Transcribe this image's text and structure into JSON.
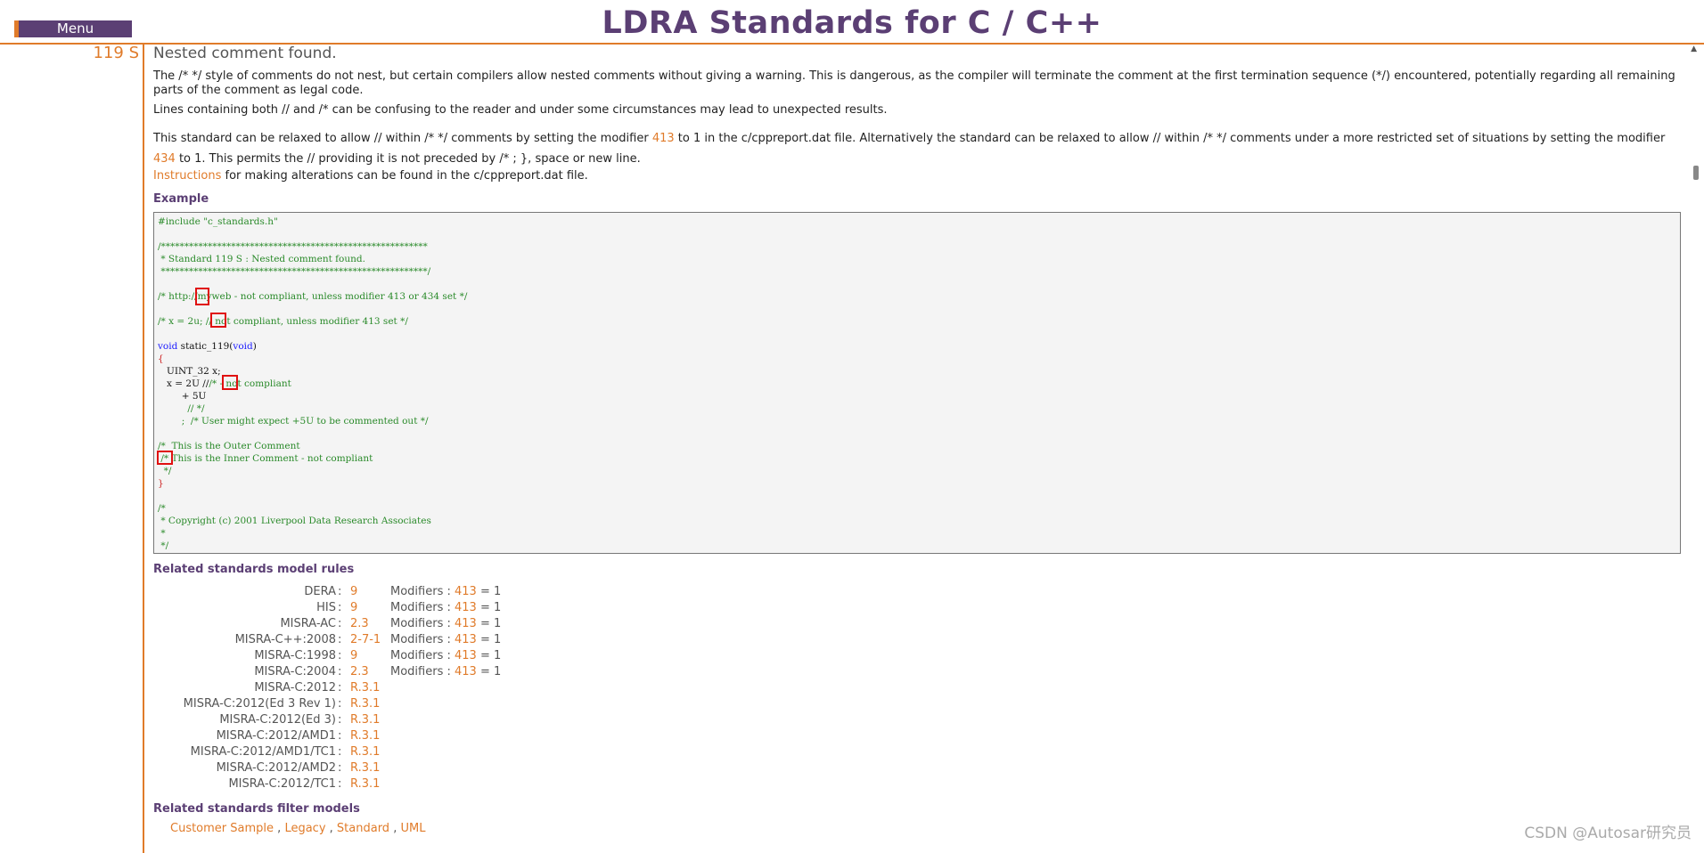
{
  "header": {
    "menu_label": "Menu",
    "title": "LDRA Standards for C / C++"
  },
  "rule": {
    "id": "119 S",
    "title": "Nested comment found.",
    "para1": "The /* */ style of comments do not nest, but certain compilers allow nested comments without giving a warning. This is dangerous, as the compiler will terminate the comment at the first termination sequence (*/) encountered, potentially regarding all remaining parts of the comment as legal code.",
    "para2": "Lines containing both // and /* can be confusing to the reader and under some circumstances may lead to unexpected results.",
    "para3a": "This standard can be relaxed to allow // within /* */ comments by setting the modifier ",
    "mod413": "413",
    "para3b": " to 1 in the c/cppreport.dat file. Alternatively the standard can be relaxed to allow // within /* */ comments under a more restricted set of situations by setting the modifier ",
    "mod434": "434",
    "para3c": " to 1. This permits the // providing it is not preceded by /* ; }, space or new line.",
    "instructions_link": "Instructions",
    "instructions_rest": " for making alterations can be found in the c/cppreport.dat file."
  },
  "example": {
    "heading": "Example",
    "lines": {
      "l1": "#include \"c_standards.h\"",
      "l2": "/*********************************************************",
      "l3": " * Standard 119 S : Nested comment found.",
      "l4": " *********************************************************/",
      "l5": "/* http://myweb - not compliant, unless modifier 413 or 434 set */",
      "l6": "/* x = 2u; // not compliant, unless modifier 413 set */",
      "l7_kw1": "void",
      "l7_mid": " static_119(",
      "l7_kw2": "void",
      "l7_end": ")",
      "l8": "{",
      "l9": "   UINT_32 x;",
      "l10a": "   x = 2U //",
      "l10b": "/*",
      "l10c": " - not compliant",
      "l11": "        + 5U",
      "l12": "          // */",
      "l13": "        ;  /* User might expect +5U to be commented out */",
      "l14": "/*  This is the Outer Comment",
      "l15": " /* This is the Inner Comment - not compliant",
      "l16": "  */",
      "l17": "}",
      "l18": "/*",
      "l19": " * Copyright (c) 2001 Liverpool Data Research Associates",
      "l20": " *",
      "l21": " */"
    }
  },
  "related_rules": {
    "heading": "Related standards model rules",
    "modifiers_label": "Modifiers : ",
    "mod_value": "413",
    "mod_eq": " = 1",
    "rows": [
      {
        "name": "DERA",
        "value": "9",
        "has_mod": true
      },
      {
        "name": "HIS",
        "value": "9",
        "has_mod": true
      },
      {
        "name": "MISRA-AC",
        "value": "2.3",
        "has_mod": true
      },
      {
        "name": "MISRA-C++:2008",
        "value": "2-7-1",
        "has_mod": true
      },
      {
        "name": "MISRA-C:1998",
        "value": "9",
        "has_mod": true
      },
      {
        "name": "MISRA-C:2004",
        "value": "2.3",
        "has_mod": true
      },
      {
        "name": "MISRA-C:2012",
        "value": "R.3.1",
        "has_mod": false
      },
      {
        "name": "MISRA-C:2012(Ed 3 Rev 1)",
        "value": "R.3.1",
        "has_mod": false
      },
      {
        "name": "MISRA-C:2012(Ed 3)",
        "value": "R.3.1",
        "has_mod": false
      },
      {
        "name": "MISRA-C:2012/AMD1",
        "value": "R.3.1",
        "has_mod": false
      },
      {
        "name": "MISRA-C:2012/AMD1/TC1",
        "value": "R.3.1",
        "has_mod": false
      },
      {
        "name": "MISRA-C:2012/AMD2",
        "value": "R.3.1",
        "has_mod": false
      },
      {
        "name": "MISRA-C:2012/TC1",
        "value": "R.3.1",
        "has_mod": false
      }
    ]
  },
  "filter_models": {
    "heading": "Related standards filter models",
    "items": [
      "Customer Sample",
      "Legacy",
      "Standard",
      "UML"
    ],
    "separator": " , "
  },
  "watermark": "CSDN @Autosar研究员"
}
